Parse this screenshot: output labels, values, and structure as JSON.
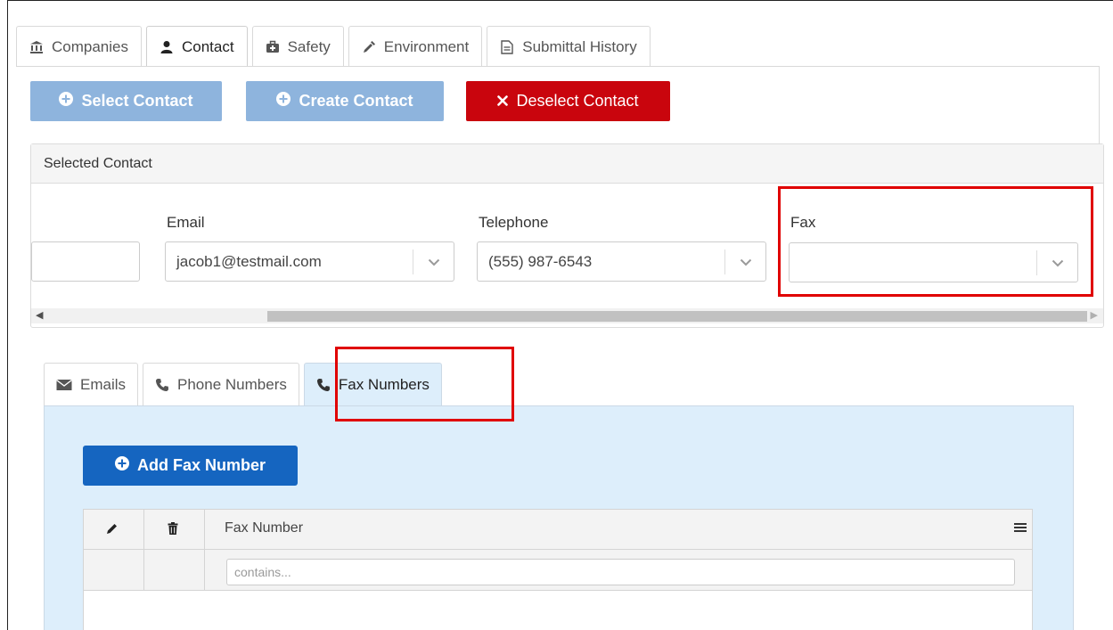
{
  "top_tabs": [
    {
      "label": "Companies",
      "icon": "bank-icon",
      "active": false
    },
    {
      "label": "Contact",
      "icon": "user-icon",
      "active": true
    },
    {
      "label": "Safety",
      "icon": "medkit-icon",
      "active": false
    },
    {
      "label": "Environment",
      "icon": "eyedropper-icon",
      "active": false
    },
    {
      "label": "Submittal History",
      "icon": "file-text-icon",
      "active": false
    }
  ],
  "actions": {
    "select_contact": "Select Contact",
    "create_contact": "Create Contact",
    "deselect_contact": "Deselect Contact"
  },
  "selected_contact": {
    "title": "Selected Contact",
    "email_label": "Email",
    "email_value": "jacob1@testmail.com",
    "telephone_label": "Telephone",
    "telephone_value": "(555) 987-6543",
    "fax_label": "Fax",
    "fax_value": ""
  },
  "inner_tabs": [
    {
      "label": "Emails",
      "icon": "envelope-icon",
      "active": false
    },
    {
      "label": "Phone Numbers",
      "icon": "phone-icon",
      "active": false
    },
    {
      "label": "Fax Numbers",
      "icon": "phone-icon",
      "active": true
    }
  ],
  "fax_panel": {
    "add_button": "Add Fax Number",
    "grid": {
      "columns": [
        "Fax Number"
      ],
      "filter_placeholder": "contains...",
      "rows": []
    }
  },
  "colors": {
    "primary": "#1565c0",
    "disabled_primary": "#8eb4dd",
    "danger": "#c9050d",
    "highlight": "#e00000",
    "tab_panel_bg": "#ddeefb"
  }
}
